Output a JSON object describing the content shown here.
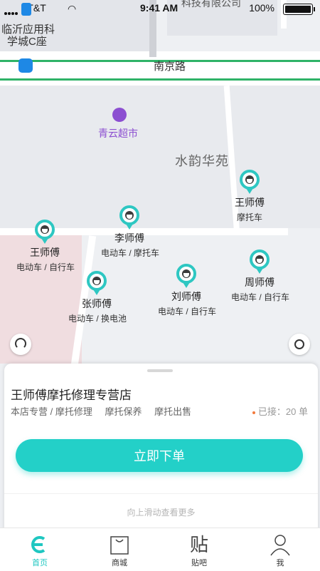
{
  "status_bar": {
    "carrier": "AT&T",
    "time": "9:41 AM",
    "battery": "100%"
  },
  "map": {
    "labels": {
      "top_company": "科技有限公司",
      "linyi_line1": "临沂应用科",
      "linyi_line2": "学城C座",
      "road": "南京路",
      "supermarket": "青云超市",
      "community": "水韵华苑"
    },
    "workers": [
      {
        "name": "王师傅",
        "type": "摩托车"
      },
      {
        "name": "李师傅",
        "type": "电动车 / 摩托车"
      },
      {
        "name": "王师傅",
        "type": "电动车 / 自行车"
      },
      {
        "name": "周师傅",
        "type": "电动车 / 自行车"
      },
      {
        "name": "刘师傅",
        "type": "电动车 / 自行车"
      },
      {
        "name": "张师傅",
        "type": "电动车 / 换电池"
      }
    ]
  },
  "sheet": {
    "shop_name": "王师傅摩托修理专营店",
    "tags": [
      "本店专营 / 摩托修理",
      "摩托保养",
      "摩托出售"
    ],
    "accepted": "已接：20 单",
    "order_button": "立即下单",
    "hint": "向上滑动查看更多"
  },
  "tabs": [
    {
      "label": "首页",
      "icon": "home-logo-icon",
      "active": true
    },
    {
      "label": "商城",
      "icon": "shopping-bag-icon",
      "active": false
    },
    {
      "label": "贴吧",
      "icon": "forum-icon",
      "active": false
    },
    {
      "label": "我",
      "icon": "user-icon",
      "active": false
    }
  ],
  "colors": {
    "accent": "#23d0c8",
    "road_green": "#2fb368",
    "poi_purple": "#8c4fd1",
    "accent_dot": "#f27a3c"
  }
}
